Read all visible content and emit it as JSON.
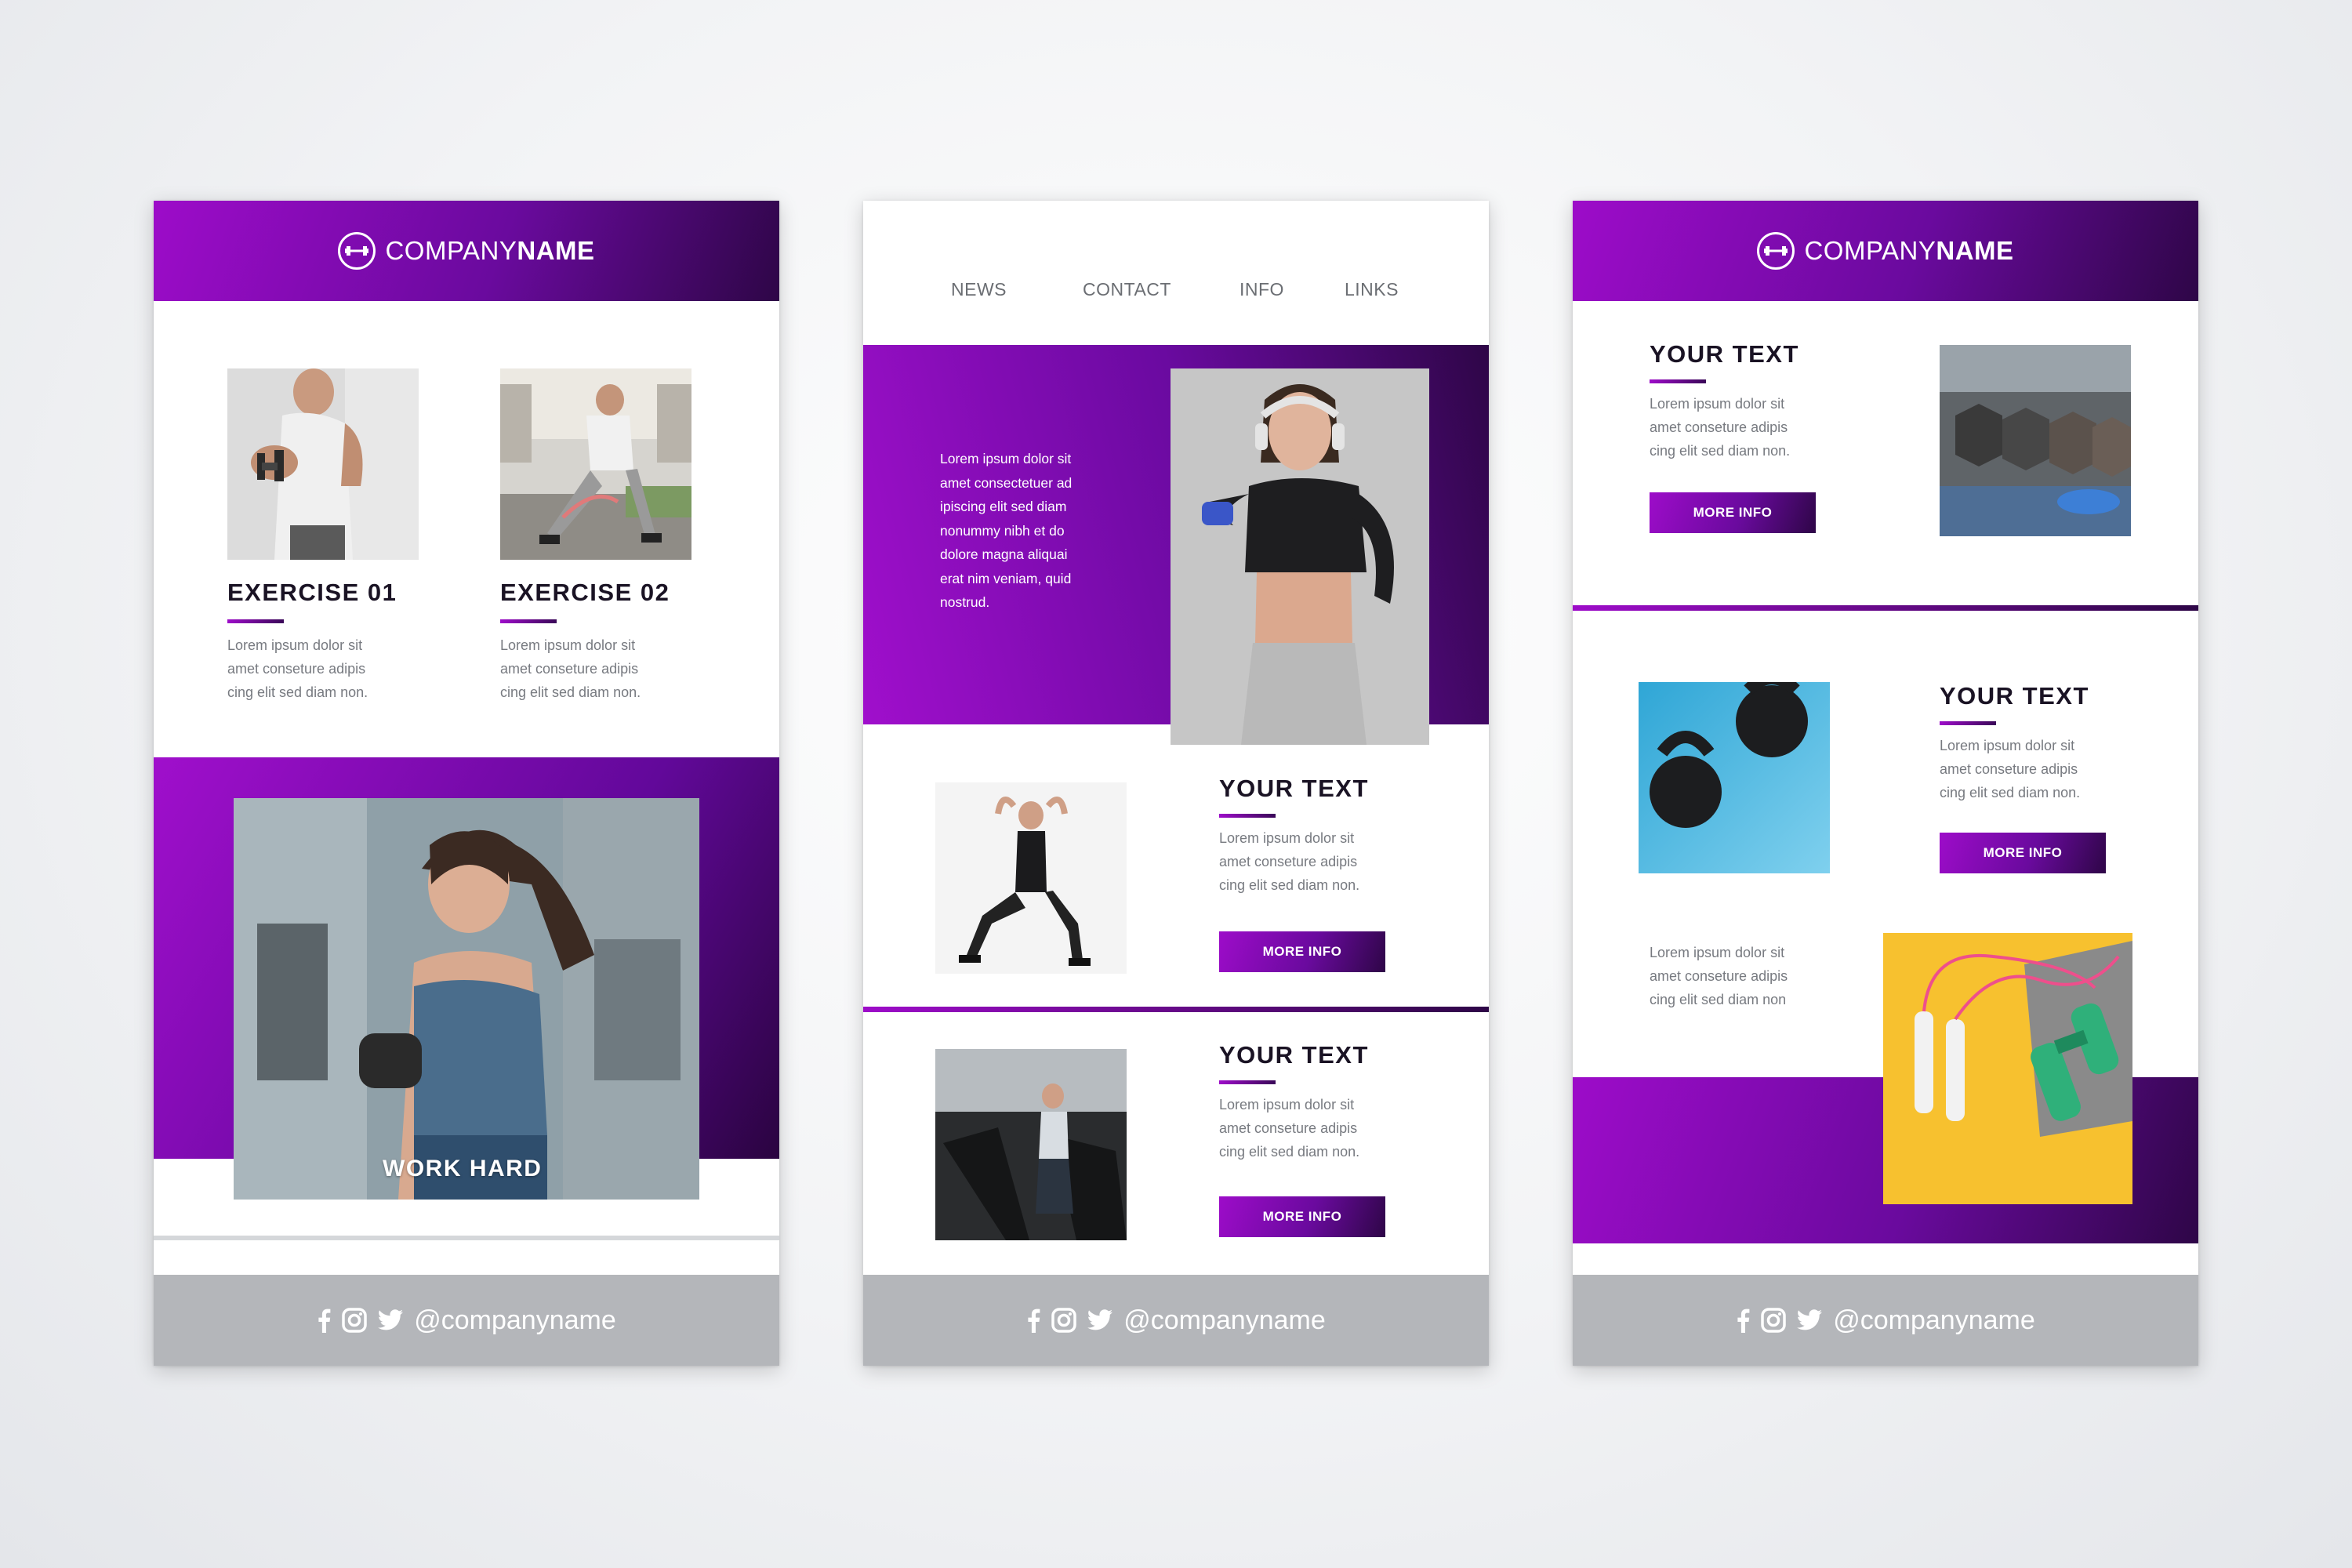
{
  "brand": {
    "company_light": "COMPANY",
    "company_bold": "NAME",
    "handle": "@companyname"
  },
  "colors": {
    "purple": "#9d0cc9",
    "dark_purple": "#2e0647",
    "footer_gray": "#b4b6ba"
  },
  "icons": [
    "dumbbell-icon",
    "facebook-icon",
    "instagram-icon",
    "twitter-icon"
  ],
  "left_card": {
    "exercises": [
      {
        "title": "EXERCISE 01",
        "text": [
          "Lorem ipsum dolor sit",
          "amet conseture adipis",
          "cing elit sed diam non."
        ]
      },
      {
        "title": "EXERCISE 02",
        "text": [
          "Lorem ipsum dolor sit",
          "amet conseture adipis",
          "cing elit sed diam non."
        ]
      }
    ],
    "hero_caption": "WORK HARD"
  },
  "middle_card": {
    "nav": [
      "NEWS",
      "CONTACT",
      "INFO",
      "LINKS"
    ],
    "hero_text": [
      "Lorem ipsum dolor sit",
      "amet consectetuer ad",
      "ipiscing elit sed diam",
      "nonummy nibh et do",
      "dolore magna aliquai",
      "erat nim veniam, quid",
      "nostrud."
    ],
    "sections": [
      {
        "title": "YOUR TEXT",
        "text": [
          "Lorem ipsum dolor sit",
          "amet conseture adipis",
          "cing elit sed diam non."
        ],
        "button": "MORE INFO"
      },
      {
        "title": "YOUR TEXT",
        "text": [
          "Lorem ipsum dolor sit",
          "amet conseture adipis",
          "cing elit sed diam non."
        ],
        "button": "MORE INFO"
      }
    ]
  },
  "right_card": {
    "sections": [
      {
        "title": "YOUR TEXT",
        "text": [
          "Lorem ipsum dolor sit",
          "amet conseture adipis",
          "cing elit sed diam non."
        ],
        "button": "MORE INFO"
      },
      {
        "title": "YOUR TEXT",
        "text": [
          "Lorem ipsum dolor sit",
          "amet conseture adipis",
          "cing elit sed diam non."
        ],
        "button": "MORE INFO"
      }
    ],
    "bottom_text": [
      "Lorem ipsum dolor sit",
      "amet conseture adipis",
      "cing elit sed diam non"
    ]
  }
}
